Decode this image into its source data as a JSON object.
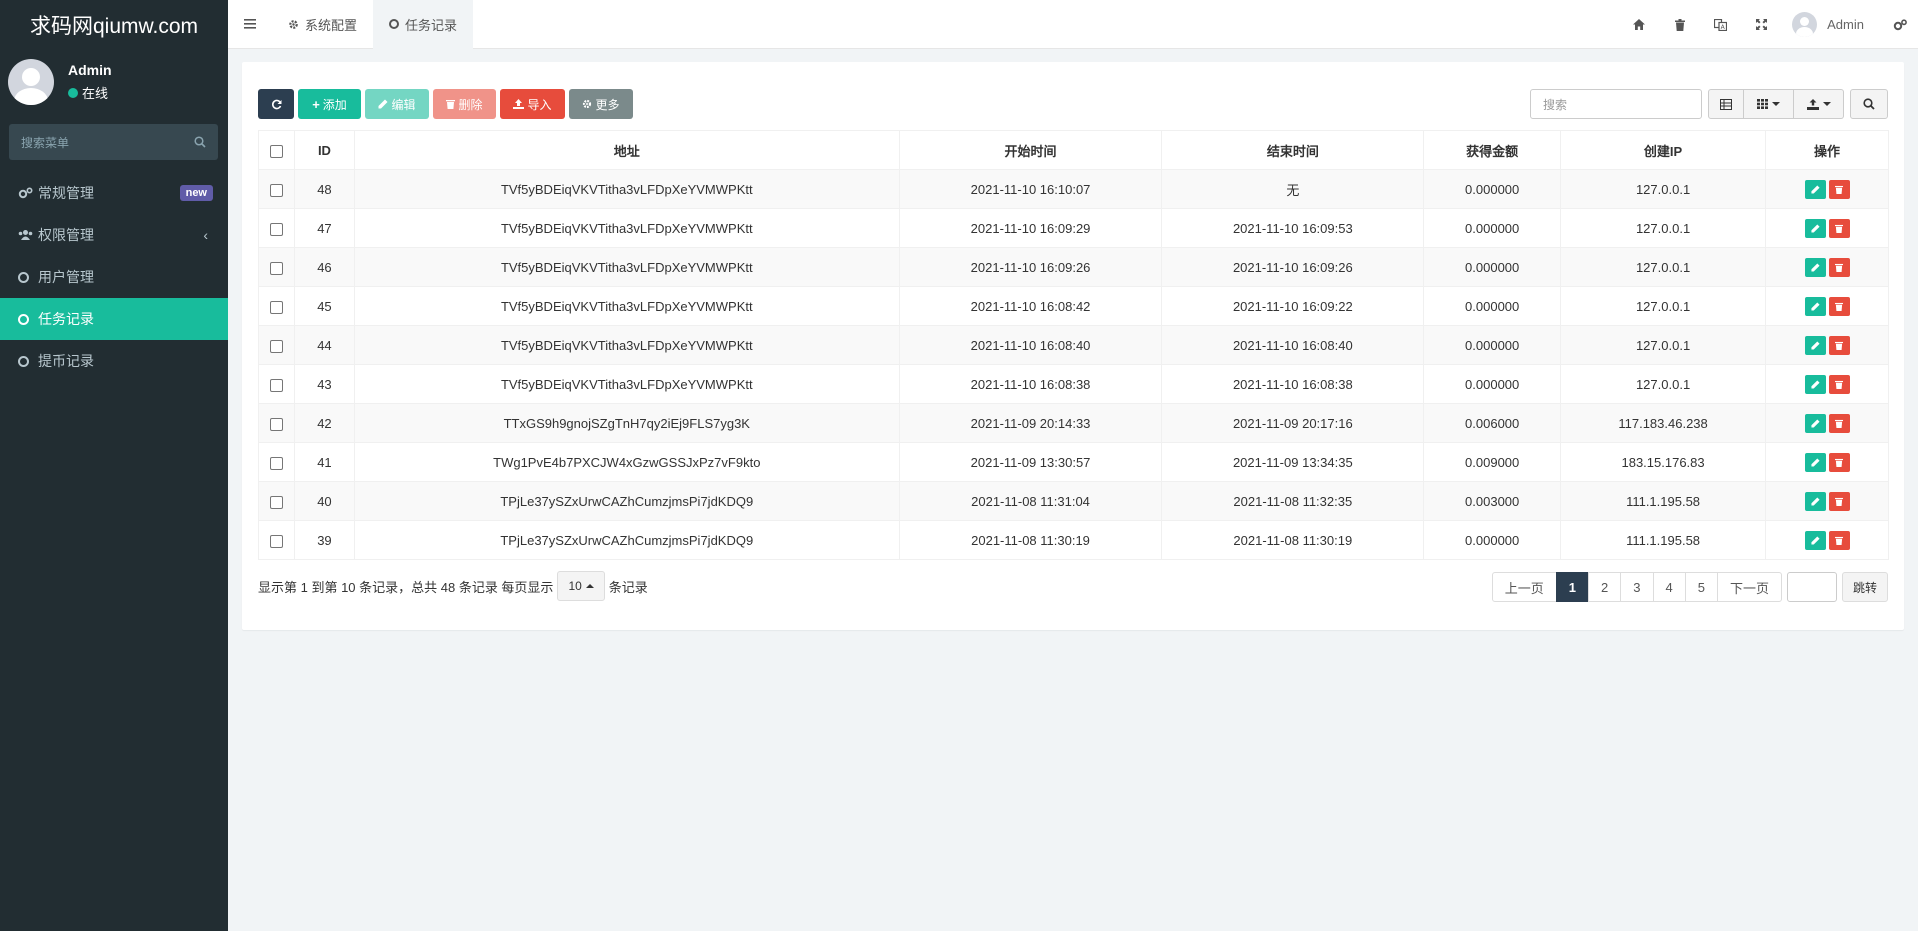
{
  "brand": "求码网qiumw.com",
  "user": {
    "name": "Admin",
    "status": "在线"
  },
  "sidebar": {
    "search_placeholder": "搜索菜单",
    "items": [
      {
        "label": "常规管理",
        "badge": "new",
        "icon": "cogs-icon"
      },
      {
        "label": "权限管理",
        "icon": "users-icon"
      },
      {
        "label": "用户管理",
        "icon": "circle-o-icon"
      },
      {
        "label": "任务记录",
        "icon": "circle-o-icon"
      },
      {
        "label": "提币记录",
        "icon": "circle-o-icon"
      }
    ]
  },
  "topbar": {
    "tabs": [
      {
        "label": "系统配置",
        "icon": "cog-icon"
      },
      {
        "label": "任务记录",
        "icon": "circle-o-icon"
      }
    ],
    "user_name": "Admin"
  },
  "toolbar": {
    "add": "添加",
    "edit": "编辑",
    "delete": "删除",
    "import": "导入",
    "more": "更多",
    "search_placeholder": "搜索"
  },
  "table": {
    "headers": [
      "ID",
      "地址",
      "开始时间",
      "结束时间",
      "获得金额",
      "创建IP",
      "操作"
    ],
    "rows": [
      {
        "id": "48",
        "address": "TVf5yBDEiqVKVTitha3vLFDpXeYVMWPKtt",
        "start": "2021-11-10 16:10:07",
        "end": "无",
        "amount": "0.000000",
        "ip": "127.0.0.1"
      },
      {
        "id": "47",
        "address": "TVf5yBDEiqVKVTitha3vLFDpXeYVMWPKtt",
        "start": "2021-11-10 16:09:29",
        "end": "2021-11-10 16:09:53",
        "amount": "0.000000",
        "ip": "127.0.0.1"
      },
      {
        "id": "46",
        "address": "TVf5yBDEiqVKVTitha3vLFDpXeYVMWPKtt",
        "start": "2021-11-10 16:09:26",
        "end": "2021-11-10 16:09:26",
        "amount": "0.000000",
        "ip": "127.0.0.1"
      },
      {
        "id": "45",
        "address": "TVf5yBDEiqVKVTitha3vLFDpXeYVMWPKtt",
        "start": "2021-11-10 16:08:42",
        "end": "2021-11-10 16:09:22",
        "amount": "0.000000",
        "ip": "127.0.0.1"
      },
      {
        "id": "44",
        "address": "TVf5yBDEiqVKVTitha3vLFDpXeYVMWPKtt",
        "start": "2021-11-10 16:08:40",
        "end": "2021-11-10 16:08:40",
        "amount": "0.000000",
        "ip": "127.0.0.1"
      },
      {
        "id": "43",
        "address": "TVf5yBDEiqVKVTitha3vLFDpXeYVMWPKtt",
        "start": "2021-11-10 16:08:38",
        "end": "2021-11-10 16:08:38",
        "amount": "0.000000",
        "ip": "127.0.0.1"
      },
      {
        "id": "42",
        "address": "TTxGS9h9gnojSZgTnH7qy2iEj9FLS7yg3K",
        "start": "2021-11-09 20:14:33",
        "end": "2021-11-09 20:17:16",
        "amount": "0.006000",
        "ip": "117.183.46.238"
      },
      {
        "id": "41",
        "address": "TWg1PvE4b7PXCJW4xGzwGSSJxPz7vF9kto",
        "start": "2021-11-09 13:30:57",
        "end": "2021-11-09 13:34:35",
        "amount": "0.009000",
        "ip": "183.15.176.83"
      },
      {
        "id": "40",
        "address": "TPjLe37ySZxUrwCAZhCumzjmsPi7jdKDQ9",
        "start": "2021-11-08 11:31:04",
        "end": "2021-11-08 11:32:35",
        "amount": "0.003000",
        "ip": "111.1.195.58"
      },
      {
        "id": "39",
        "address": "TPjLe37ySZxUrwCAZhCumzjmsPi7jdKDQ9",
        "start": "2021-11-08 11:30:19",
        "end": "2021-11-08 11:30:19",
        "amount": "0.000000",
        "ip": "111.1.195.58"
      }
    ]
  },
  "footer": {
    "summary": "显示第 1 到第 10 条记录，总共 48 条记录 每页显示",
    "page_size": "10",
    "suffix": "条记录"
  },
  "pagination": {
    "prev": "上一页",
    "pages": [
      "1",
      "2",
      "3",
      "4",
      "5"
    ],
    "active": "1",
    "next": "下一页",
    "jump": "跳转"
  },
  "colors": {
    "sidebar_bg": "#222d32",
    "accent": "#18bc9c",
    "danger": "#e74c3c",
    "primary_dark": "#2c3e50",
    "badge": "#605ca8"
  }
}
